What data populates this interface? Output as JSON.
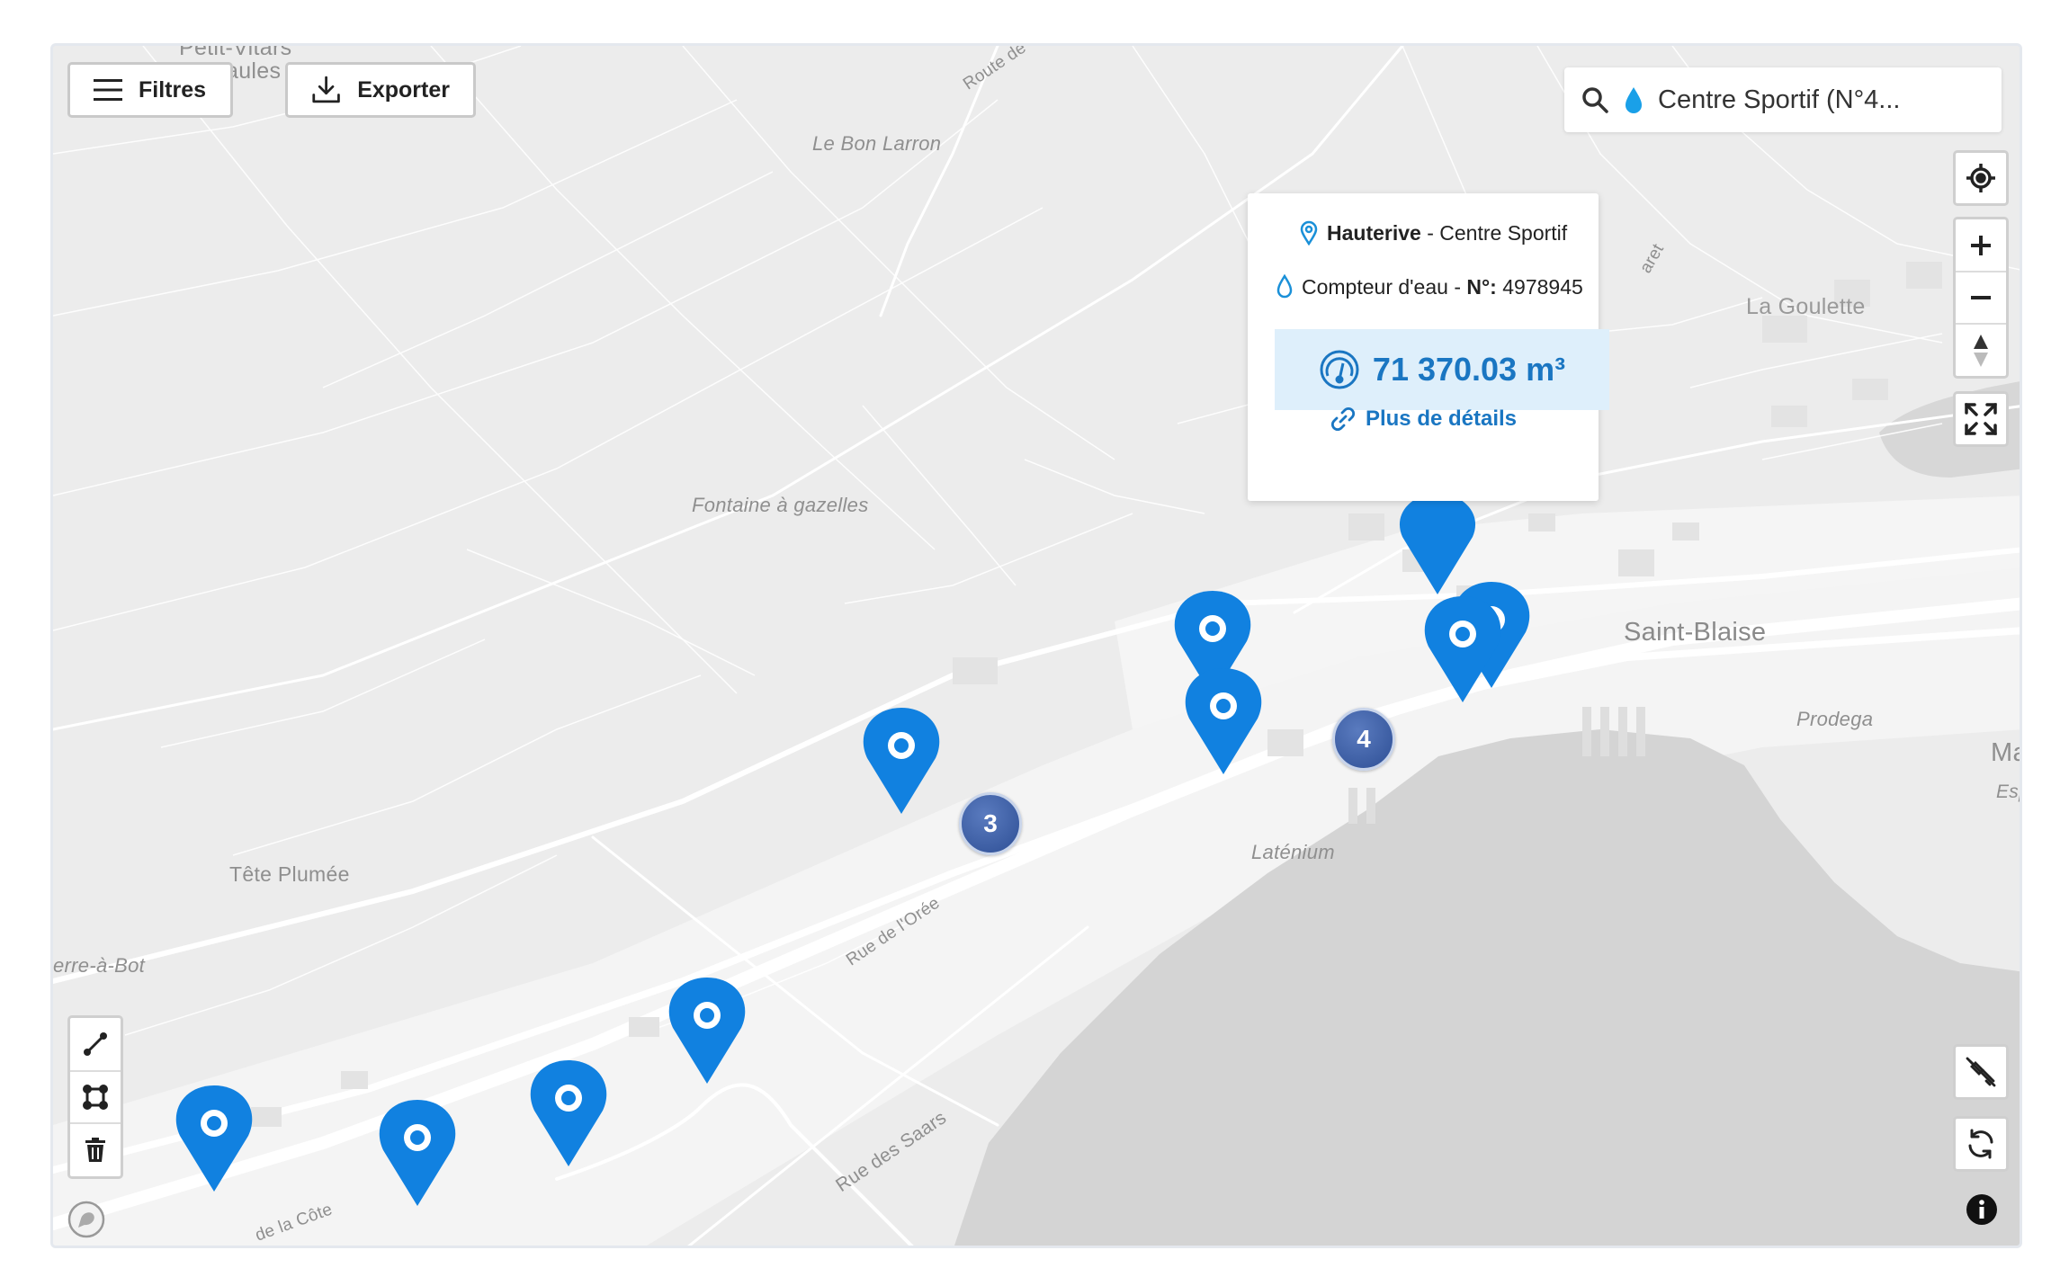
{
  "toolbar": {
    "filters_label": "Filtres",
    "export_label": "Exporter"
  },
  "search": {
    "value": "Centre Sportif (N°4..."
  },
  "popup": {
    "location_bold": "Hauterive",
    "location_rest": " - Centre Sportif",
    "meter_type": "Compteur d'eau - ",
    "meter_no_label": "N°:",
    "meter_no": " 4978945",
    "reading": "71 370.03 m³",
    "details_link": "Plus de détails"
  },
  "clusters": [
    {
      "count": "3"
    },
    {
      "count": "4"
    }
  ],
  "map_labels": {
    "petit_vitars": "Petit-Vitars",
    "aules": "aules",
    "route_chaumont": "Route de Chau",
    "bon_larron": "Le Bon Larron",
    "fontaine": "Fontaine à gazelles",
    "tete_plumee": "Tête Plumée",
    "pierre_a_bot": "erre-à-Bot",
    "rue_oree": "Rue de l'Orée",
    "rue_saars": "Rue des Saars",
    "rue_cote": "de la Côte",
    "latenium": "Laténium",
    "saint_blaise": "Saint-Blaise",
    "prodega": "Prodega",
    "la_goulette": "La Goulette",
    "ma": "Ma",
    "esp": "Esp",
    "aret": "aret"
  },
  "colors": {
    "pin": "#1181e0",
    "cluster": "#3a5aa0",
    "accent": "#1a76c2",
    "water": "#d4d4d4",
    "land": "#ececec"
  },
  "icons": {
    "filters": "menu-icon",
    "export": "download-icon",
    "search": "search-icon",
    "water": "water-drop-icon",
    "locate": "locate-icon",
    "zoom_in": "plus-icon",
    "zoom_out": "minus-icon",
    "compass": "compass-icon",
    "fullscreen": "fullscreen-icon",
    "draw_line": "draw-line-icon",
    "draw_polygon": "draw-polygon-icon",
    "delete": "trash-icon",
    "satellite": "satellite-icon",
    "refresh": "refresh-icon",
    "info": "info-icon",
    "logo": "mapbox-logo-icon"
  }
}
